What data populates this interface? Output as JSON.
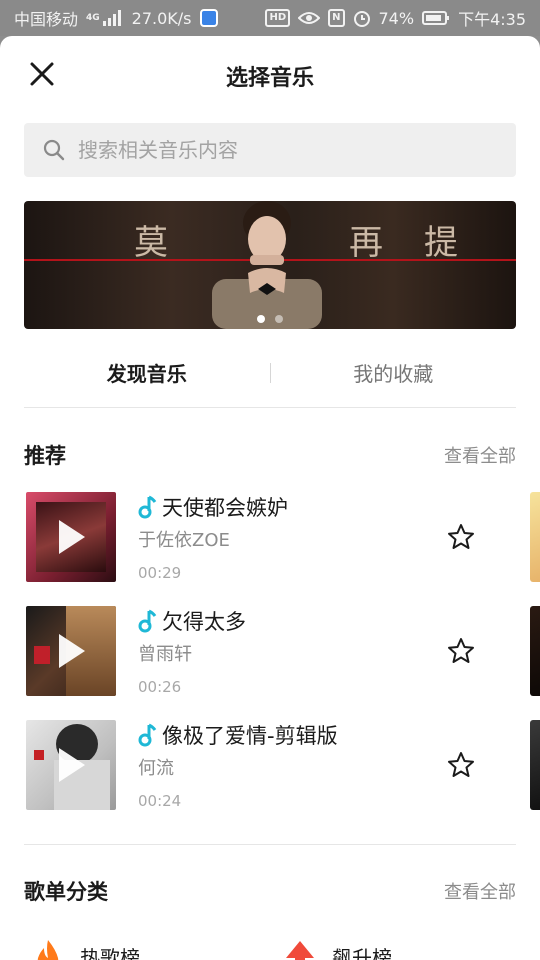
{
  "status_bar": {
    "carrier": "中国移动",
    "network_badge": "4G",
    "speed": "27.0K/s",
    "battery": "74%",
    "time": "下午4:35",
    "icons": [
      "signal-icon",
      "shield-app-icon",
      "hd-icon",
      "eye-icon",
      "nfc-icon",
      "alarm-icon",
      "battery-icon"
    ]
  },
  "header": {
    "title": "选择音乐",
    "close_icon": "close-icon"
  },
  "search": {
    "placeholder": "搜索相关音乐内容",
    "icon": "search-icon"
  },
  "banner": {
    "chars": [
      "莫",
      "再",
      "提"
    ],
    "slide_count": 2,
    "active_slide": 0,
    "accent": "#b3131a"
  },
  "tabs": [
    {
      "label": "发现音乐",
      "active": true
    },
    {
      "label": "我的收藏",
      "active": false
    }
  ],
  "recommend": {
    "title": "推荐",
    "see_all": "查看全部",
    "songs": [
      {
        "title": "天使都会嫉妒",
        "artist": "于佐依ZOE",
        "duration": "00:29"
      },
      {
        "title": "欠得太多",
        "artist": "曾雨轩",
        "duration": "00:26"
      },
      {
        "title": "像极了爱情-剪辑版",
        "artist": "何流",
        "duration": "00:24"
      }
    ]
  },
  "playlists": {
    "title": "歌单分类",
    "see_all": "查看全部",
    "categories": [
      {
        "label": "热歌榜",
        "icon": "fire-icon"
      },
      {
        "label": "飙升榜",
        "icon": "arrow-up-icon"
      }
    ]
  },
  "colors": {
    "note_accent": "#1fb8d6",
    "hot_icon": "#ff7a1a",
    "rise_icon": "#f04a3a"
  }
}
